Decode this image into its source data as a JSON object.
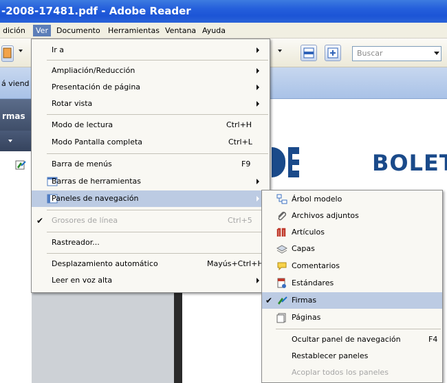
{
  "window": {
    "title": "-2008-17481.pdf - Adobe Reader"
  },
  "menubar": {
    "items": [
      "dición",
      "Ver",
      "Documento",
      "Herramientas",
      "Ventana",
      "Ayuda"
    ]
  },
  "toolbar": {
    "search_placeholder": "Buscar"
  },
  "docbar": {
    "text": "á viend"
  },
  "leftpanel": {
    "header": "rmas"
  },
  "page": {
    "logo_text": "BOLET"
  },
  "ver_menu": {
    "items": [
      {
        "label": "Ir a",
        "shortcut": "",
        "submenu": true
      },
      {
        "label": "Ampliación/Reducción",
        "shortcut": "",
        "submenu": true
      },
      {
        "label": "Presentación de página",
        "shortcut": "",
        "submenu": true
      },
      {
        "label": "Rotar vista",
        "shortcut": "",
        "submenu": true
      },
      {
        "label": "Modo de lectura",
        "shortcut": "Ctrl+H",
        "submenu": false
      },
      {
        "label": "Modo Pantalla completa",
        "shortcut": "Ctrl+L",
        "submenu": false
      },
      {
        "label": "Barra de menús",
        "shortcut": "F9",
        "submenu": false
      },
      {
        "label": "Barras de herramientas",
        "shortcut": "",
        "submenu": true
      },
      {
        "label": "Paneles de navegación",
        "shortcut": "",
        "submenu": true,
        "highlighted": true
      },
      {
        "label": "Grosores de línea",
        "shortcut": "Ctrl+5",
        "submenu": false,
        "disabled": true,
        "checked": true
      },
      {
        "label": "Rastreador...",
        "shortcut": "",
        "submenu": false
      },
      {
        "label": "Desplazamiento automático",
        "shortcut": "Mayús+Ctrl+H",
        "submenu": false
      },
      {
        "label": "Leer en voz alta",
        "shortcut": "",
        "submenu": true
      }
    ]
  },
  "paneles_submenu": {
    "items": [
      {
        "label": "Árbol modelo",
        "icon": "model-tree-icon"
      },
      {
        "label": "Archivos adjuntos",
        "icon": "paperclip-icon"
      },
      {
        "label": "Artículos",
        "icon": "articles-icon"
      },
      {
        "label": "Capas",
        "icon": "layers-icon"
      },
      {
        "label": "Comentarios",
        "icon": "comment-icon"
      },
      {
        "label": "Estándares",
        "icon": "standards-icon"
      },
      {
        "label": "Firmas",
        "icon": "signature-icon",
        "checked": true,
        "highlighted": true
      },
      {
        "label": "Páginas",
        "icon": "pages-icon"
      },
      {
        "label": "Ocultar panel de navegación",
        "shortcut": "F4"
      },
      {
        "label": "Restablecer paneles"
      },
      {
        "label": "Acoplar todos los paneles",
        "disabled": true
      }
    ]
  }
}
